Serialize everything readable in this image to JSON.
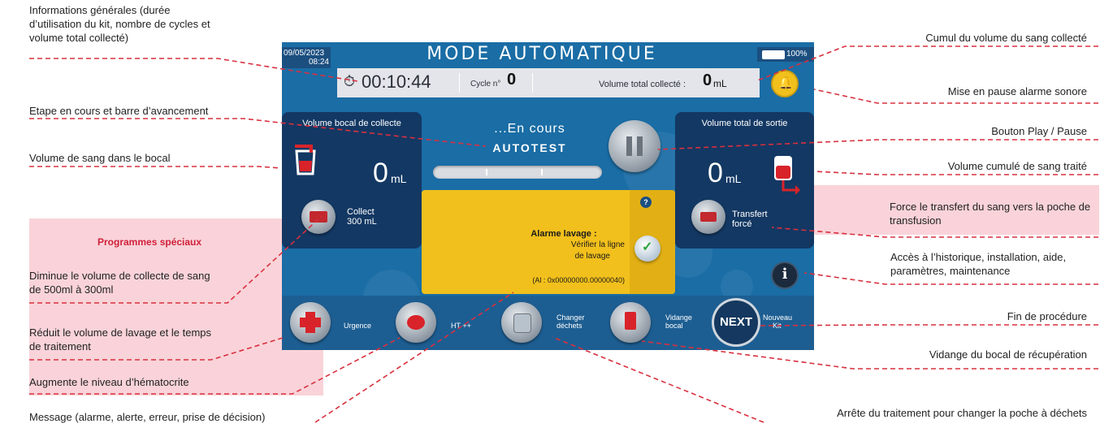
{
  "annotations": {
    "infos_generales": "Informations générales (durée d’utilisation du kit, nombre de cycles et volume total collecté)",
    "etape": "Etape en cours et barre d’avancement",
    "volume_bocal": "Volume de sang dans le bocal",
    "cumul_volume": "Cumul du volume du sang collecté",
    "pause_alarme": "Mise en pause alarme sonore",
    "play_pause": "Bouton Play / Pause",
    "volume_cumule": "Volume cumulé de sang traité",
    "force_transfert": "Force le transfert du sang vers la poche de transfusion",
    "acces": "Accès à l’historique, installation, aide, paramètres, maintenance",
    "fin_procedure": "Fin de procédure",
    "vidange": "Vidange du bocal de récupération",
    "arret_traitement": "Arrête du traitement pour changer la poche à déchets",
    "message": "Message (alarme, alerte, erreur, prise de décision)"
  },
  "special_programs": {
    "title": "Programmes spéciaux",
    "diminue": "Diminue le volume de collecte de sang de 500ml à 300ml",
    "reduit": "Réduit le volume de lavage et le temps de traitement",
    "augmente": "Augmente le niveau d’hématocrite"
  },
  "screen": {
    "date": "09/05/2023",
    "time": "08:24",
    "title": "MODE AUTOMATIQUE",
    "battery": "100%",
    "timer": "00:10:44",
    "cycle_label": "Cycle n°",
    "cycle_value": "0",
    "volume_total_label": "Volume total collecté :",
    "volume_total_value": "0",
    "volume_total_unit": "mL",
    "left_panel_title": "Volume bocal de collecte",
    "left_volume": "0",
    "left_unit": "mL",
    "collect_label_1": "Collect",
    "collect_label_2": "300 mL",
    "status_line": "...En cours",
    "status_step": "AUTOTEST",
    "right_panel_title": "Volume total de sortie",
    "right_volume": "0",
    "right_unit": "mL",
    "transfert_label_1": "Transfert",
    "transfert_label_2": "forcé",
    "alarm_title": "Alarme lavage :",
    "alarm_line1": "Vérifier la ligne",
    "alarm_line2": "de lavage",
    "alarm_code": "(Al : 0x00000000.00000040)",
    "help_glyph": "?",
    "info_glyph": "i",
    "btn_urgence": "Urgence",
    "btn_ht": "HT ++",
    "btn_changer_1": "Changer",
    "btn_changer_2": "déchets",
    "btn_vidange_1": "Vidange",
    "btn_vidange_2": "bocal",
    "btn_next": "NEXT",
    "btn_nouveau_1": "Nouveau",
    "btn_nouveau_2": "Kit"
  },
  "colors": {
    "screen_bg": "#1a6da5",
    "panel_bg": "#133863",
    "alarm_bg": "#f2c01c",
    "annotation_line": "#d9303f",
    "pink_box": "#f9d3d9"
  }
}
